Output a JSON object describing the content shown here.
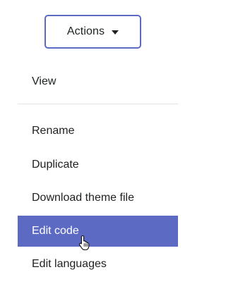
{
  "actions_button": {
    "label": "Actions",
    "icon": "caret-down-icon"
  },
  "menu": {
    "items": [
      {
        "label": "View"
      },
      {
        "label": "Rename"
      },
      {
        "label": "Duplicate"
      },
      {
        "label": "Download theme file"
      },
      {
        "label": "Edit code",
        "state": "hovered"
      },
      {
        "label": "Edit languages"
      }
    ]
  },
  "colors": {
    "accent": "#5c6ac4",
    "text": "#202223",
    "divider": "#e1e3e5",
    "active_text": "#ffffff"
  },
  "cursor": {
    "icon": "hand-pointer-icon"
  }
}
